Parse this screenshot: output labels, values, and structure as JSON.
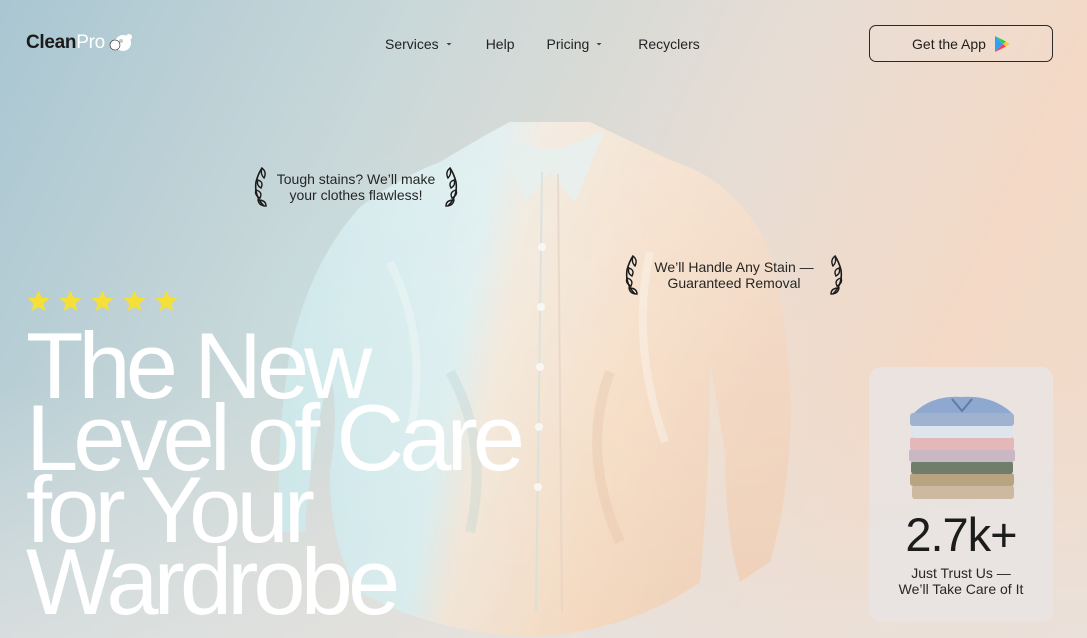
{
  "brand": {
    "name_bold": "Clean",
    "name_light": "Pro",
    "logo_icon": "bubbles-icon"
  },
  "nav": {
    "items": [
      {
        "label": "Services",
        "has_dropdown": true
      },
      {
        "label": "Help",
        "has_dropdown": false
      },
      {
        "label": "Pricing",
        "has_dropdown": true
      },
      {
        "label": "Recyclers",
        "has_dropdown": false
      }
    ]
  },
  "cta": {
    "label": "Get the App",
    "icon": "google-play-icon"
  },
  "awards": [
    {
      "text": "Tough stains? We’ll make your clothes flawless!",
      "icon": "laurel-icon"
    },
    {
      "text": "We’ll Handle Any Stain — Guaranteed Removal",
      "icon": "laurel-icon"
    }
  ],
  "rating": {
    "stars": 5,
    "max": 5,
    "color": "#f5e03a"
  },
  "hero": {
    "lines": [
      "The New",
      "Level of Care",
      "for Your",
      "Wardrobe"
    ]
  },
  "stat": {
    "value": "2.7k+",
    "caption_line1": "Just Trust Us —",
    "caption_line2": "We’ll Take Care of It",
    "image": "folded-shirts-stack"
  },
  "colors": {
    "accent_star": "#f5e03a",
    "text_dark": "#1f1f1f",
    "hero_text": "#ffffff"
  }
}
